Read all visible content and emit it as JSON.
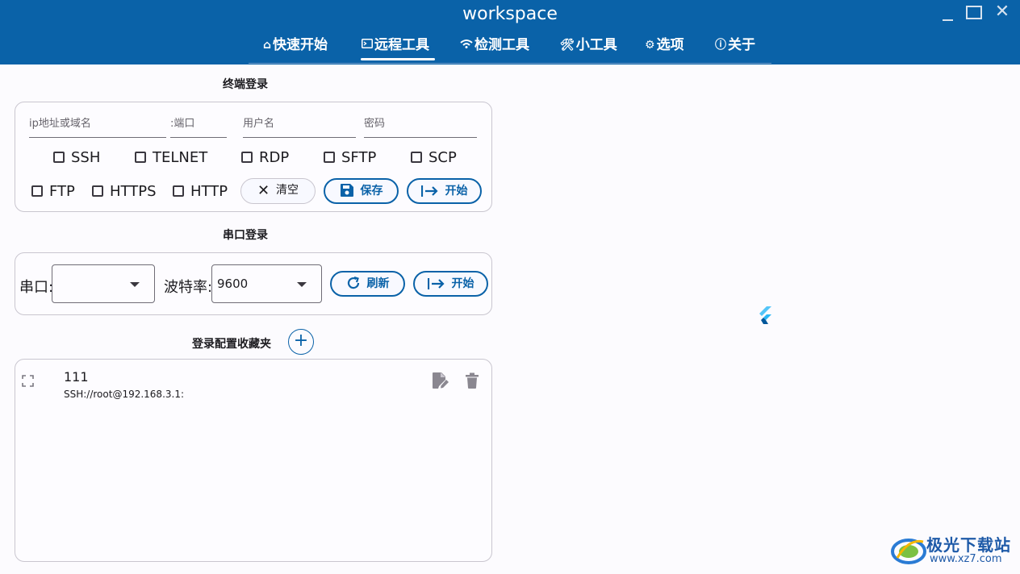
{
  "window": {
    "title": "workspace"
  },
  "tabs": [
    {
      "label": "快速开始",
      "icon": "home-icon"
    },
    {
      "label": "远程工具",
      "icon": "terminal-icon",
      "active": true
    },
    {
      "label": "检测工具",
      "icon": "wifi-icon"
    },
    {
      "label": "小工具",
      "icon": "tools-icon"
    },
    {
      "label": "选项",
      "icon": "gear-icon"
    },
    {
      "label": "关于",
      "icon": "info-icon"
    }
  ],
  "terminal_login": {
    "title": "终端登录",
    "host_placeholder": "ip地址或域名",
    "port_placeholder": ":端口",
    "username_placeholder": "用户名",
    "password_placeholder": "密码",
    "protocols": [
      "SSH",
      "TELNET",
      "RDP",
      "SFTP",
      "SCP",
      "FTP",
      "HTTPS",
      "HTTP"
    ],
    "clear_label": "清空",
    "save_label": "保存",
    "start_label": "开始"
  },
  "serial_login": {
    "title": "串口登录",
    "port_label": "串口:",
    "port_value": "",
    "baud_label": "波特率:",
    "baud_value": "9600",
    "refresh_label": "刷新",
    "start_label": "开始"
  },
  "favorites": {
    "title": "登录配置收藏夹",
    "items": [
      {
        "name": "111",
        "detail": "SSH://root@192.168.3.1:"
      }
    ]
  },
  "watermark": {
    "text": "极光下载站",
    "url": "www.xz7.com"
  },
  "colors": {
    "primary": "#0a62a8",
    "background": "#fcfbfe",
    "border": "#c9c6cf"
  }
}
